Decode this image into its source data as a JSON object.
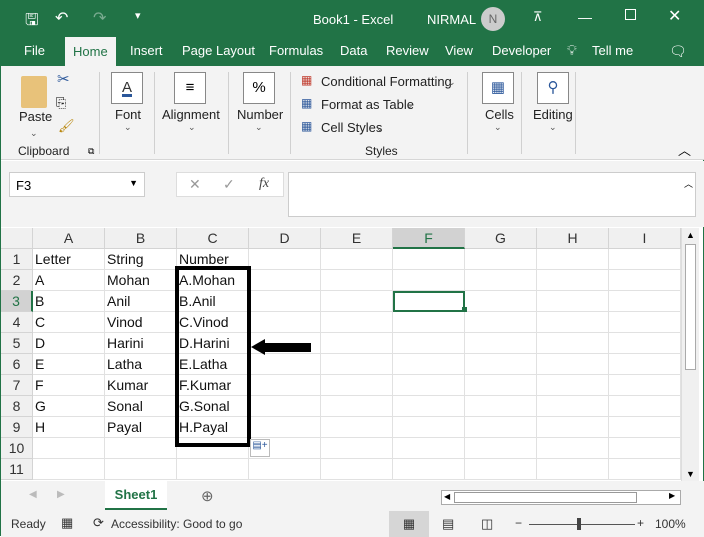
{
  "title_bar": {
    "title": "Book1  -  Excel",
    "user": "NIRMAL",
    "avatar_initial": "N"
  },
  "tabs": [
    "File",
    "Home",
    "Insert",
    "Page Layout",
    "Formulas",
    "Data",
    "Review",
    "View",
    "Developer",
    "Tell me"
  ],
  "ribbon": {
    "paste": "Paste",
    "clipboard": "Clipboard",
    "font": "Font",
    "alignment": "Alignment",
    "number": "Number",
    "conditional_formatting": "Conditional Formatting",
    "format_as_table": "Format as Table",
    "cell_styles": "Cell Styles",
    "styles": "Styles",
    "cells": "Cells",
    "editing": "Editing"
  },
  "formula_bar": {
    "name_box": "F3",
    "formula": "",
    "fx": "fx"
  },
  "columns": [
    "A",
    "B",
    "C",
    "D",
    "E",
    "F",
    "G",
    "H",
    "I"
  ],
  "rows": [
    [
      "Letter",
      "String",
      "Number"
    ],
    [
      "A",
      "Mohan",
      "A.Mohan"
    ],
    [
      "B",
      "Anil",
      "B.Anil"
    ],
    [
      "C",
      "Vinod",
      "C.Vinod"
    ],
    [
      "D",
      "Harini",
      "D.Harini"
    ],
    [
      "E",
      "Latha",
      "E.Latha"
    ],
    [
      "F",
      "Kumar",
      "F.Kumar"
    ],
    [
      "G",
      "Sonal",
      "G.Sonal"
    ],
    [
      "H",
      "Payal",
      "H.Payal"
    ],
    [
      "",
      "",
      ""
    ],
    [
      "",
      "",
      ""
    ]
  ],
  "row_numbers": [
    "1",
    "2",
    "3",
    "4",
    "5",
    "6",
    "7",
    "8",
    "9",
    "10",
    "11"
  ],
  "selected_cell": "F3",
  "sheet_tab": "Sheet1",
  "status": {
    "ready": "Ready",
    "accessibility": "Accessibility: Good to go",
    "zoom": "100%"
  },
  "colors": {
    "accent": "#217346"
  }
}
